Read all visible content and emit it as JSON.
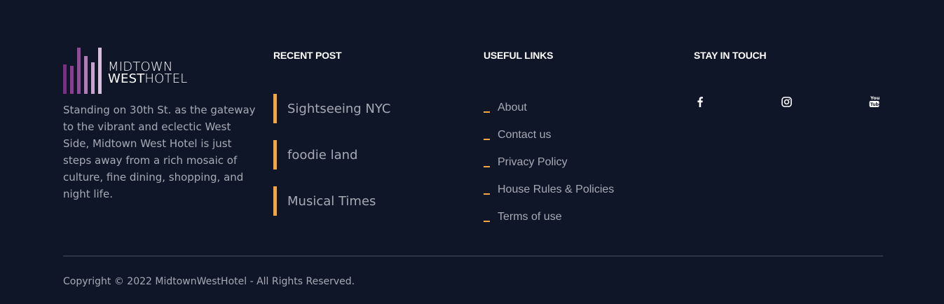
{
  "brand": {
    "logo_line1": "MIDTOWN",
    "logo_line2_bold": "WEST",
    "logo_line2_light": "HOTEL",
    "description": "Standing on 30th St. as the gateway to the vibrant and eclectic West Side, Midtown West Hotel is just steps away from a rich mosaic of culture, fine dining, shopping, and night life."
  },
  "recent_post": {
    "title": "RECENT POST",
    "items": [
      {
        "label": "Sightseeing NYC"
      },
      {
        "label": "foodie land"
      },
      {
        "label": "Musical Times"
      }
    ]
  },
  "useful_links": {
    "title": "USEFUL LINKS",
    "items": [
      {
        "label": "About"
      },
      {
        "label": "Contact us"
      },
      {
        "label": "Privacy Policy"
      },
      {
        "label": "House Rules & Policies"
      },
      {
        "label": "Terms of use"
      }
    ]
  },
  "stay_in_touch": {
    "title": "STAY IN TOUCH",
    "icons": [
      "facebook-icon",
      "instagram-icon",
      "youtube-icon"
    ]
  },
  "footer": {
    "copyright": "Copyright © 2022 MidtownWestHotel - All Rights Reserved."
  },
  "colors": {
    "background": "#0f1628",
    "accent": "#f5a640",
    "text_muted": "#a7aab3",
    "heading": "#ffffff",
    "logo_purple_dark": "#7a2e86",
    "logo_purple_light": "#c9a3cf"
  }
}
